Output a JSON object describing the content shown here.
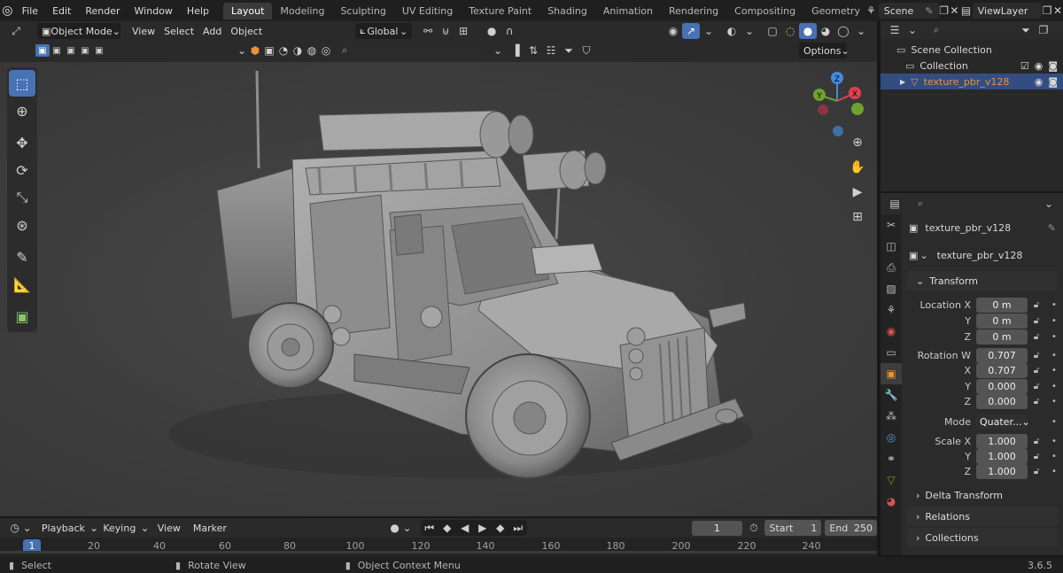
{
  "topbar": {
    "menu": [
      "File",
      "Edit",
      "Render",
      "Window",
      "Help"
    ],
    "workspaces": [
      "Layout",
      "Modeling",
      "Sculpting",
      "UV Editing",
      "Texture Paint",
      "Shading",
      "Animation",
      "Rendering",
      "Compositing",
      "Geometry Noc"
    ],
    "active_workspace": "Layout",
    "scene": "Scene",
    "view_layer": "ViewLayer"
  },
  "viewport_header": {
    "mode": "Object Mode",
    "menus": [
      "View",
      "Select",
      "Add",
      "Object"
    ],
    "orientation": "Global",
    "options": "Options"
  },
  "outliner": {
    "scene_collection": "Scene Collection",
    "collection": "Collection",
    "object": "texture_pbr_v128"
  },
  "properties": {
    "object_name": "texture_pbr_v128",
    "data_name": "texture_pbr_v128",
    "transform": "Transform",
    "location": {
      "label_x": "Location X",
      "label_y": "Y",
      "label_z": "Z",
      "x": "0 m",
      "y": "0 m",
      "z": "0 m"
    },
    "rotation": {
      "label_w": "Rotation W",
      "label_x": "X",
      "label_y": "Y",
      "label_z": "Z",
      "w": "0.707",
      "x": "0.707",
      "y": "0.000",
      "z": "0.000"
    },
    "mode_label": "Mode",
    "mode_value": "Quater...",
    "scale": {
      "label_x": "Scale X",
      "label_y": "Y",
      "label_z": "Z",
      "x": "1.000",
      "y": "1.000",
      "z": "1.000"
    },
    "delta_transform": "Delta Transform",
    "relations": "Relations",
    "collections": "Collections"
  },
  "timeline": {
    "menus": [
      "Playback",
      "Keying",
      "View",
      "Marker"
    ],
    "current_frame": "1",
    "start_label": "Start",
    "start": "1",
    "end_label": "End",
    "end": "250",
    "ruler_current": "1",
    "ticks": [
      "20",
      "40",
      "60",
      "80",
      "100",
      "120",
      "140",
      "160",
      "180",
      "200",
      "220",
      "240"
    ]
  },
  "status": {
    "select": "Select",
    "rotate": "Rotate View",
    "context": "Object Context Menu",
    "version": "3.6.5"
  },
  "gizmo": {
    "x": "X",
    "y": "Y",
    "z": "Z"
  },
  "colors": {
    "accent": "#4772b3",
    "selected_object": "#e8923b",
    "x_axis": "#e0414f",
    "y_axis": "#6da22c",
    "z_axis": "#3f8de0"
  }
}
